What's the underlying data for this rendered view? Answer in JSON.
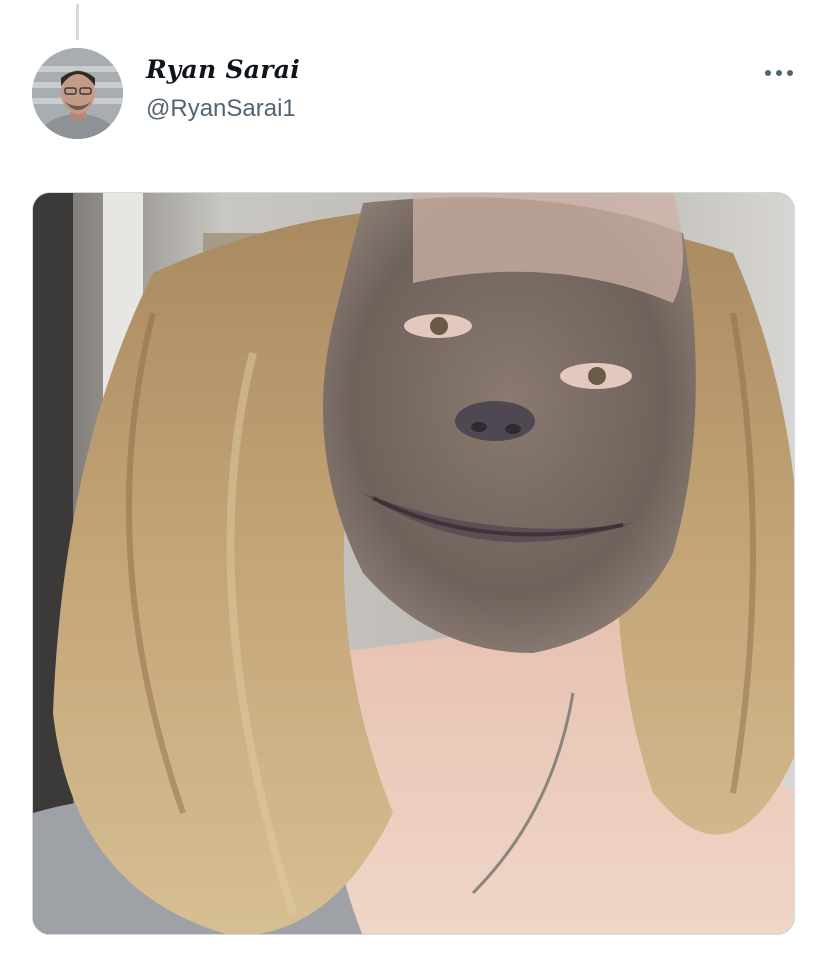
{
  "tweet": {
    "author": {
      "display_name": "Ryan Sarai",
      "handle": "@RyanSarai1",
      "avatar_icon": "avatar-photo"
    },
    "more_icon": "more-horizontal-icon",
    "media": {
      "type": "photo",
      "icon": "attached-photo"
    }
  },
  "colors": {
    "text_primary": "#0f1419",
    "text_secondary": "#536471",
    "border": "#cfd9de",
    "background": "#ffffff"
  }
}
